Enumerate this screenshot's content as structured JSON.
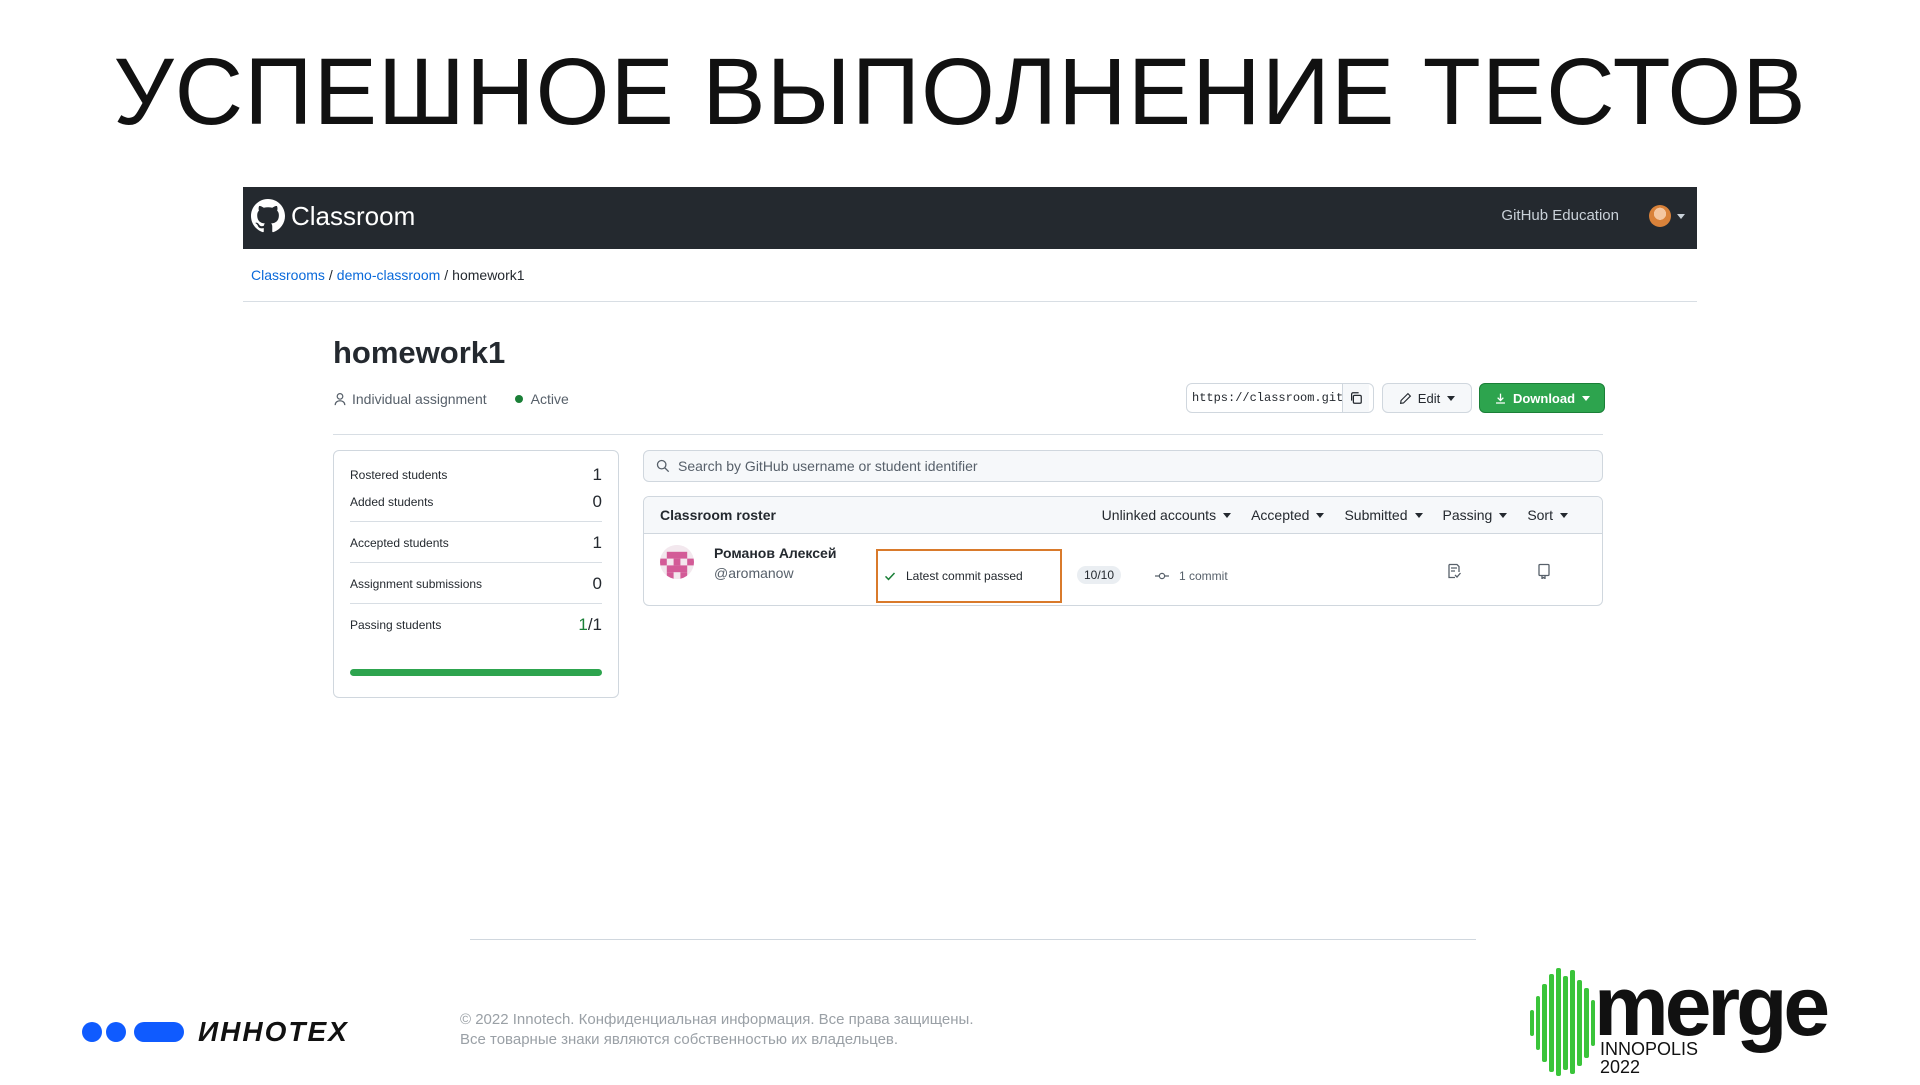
{
  "slide": {
    "title": "УСПЕШНОЕ ВЫПОЛНЕНИЕ ТЕСТОВ"
  },
  "topbar": {
    "app_name": "Classroom",
    "github_education": "GitHub Education",
    "logo_icon": "github-octocat-icon"
  },
  "breadcrumb": {
    "classrooms": "Classrooms",
    "classroom": "demo-classroom",
    "assignment": "homework1",
    "separator": "/"
  },
  "assignment": {
    "title": "homework1",
    "type": "Individual assignment",
    "status": "Active",
    "status_color": "#1a7f37",
    "url": "https://classroom.git",
    "edit_label": "Edit",
    "download_label": "Download",
    "download_color": "#2da44e"
  },
  "stats": {
    "rostered_label": "Rostered students",
    "rostered_value": "1",
    "added_label": "Added students",
    "added_value": "0",
    "accepted_label": "Accepted students",
    "accepted_value": "1",
    "submissions_label": "Assignment submissions",
    "submissions_value": "0",
    "passing_label": "Passing students",
    "passing_num": "1",
    "passing_den": "/1",
    "passing_fraction": 1.0
  },
  "search": {
    "placeholder": "Search by GitHub username or student identifier"
  },
  "roster": {
    "title": "Classroom roster",
    "filters": [
      "Unlinked accounts",
      "Accepted",
      "Submitted",
      "Passing",
      "Sort"
    ],
    "student": {
      "name": "Романов Алексей",
      "login": "@aromanow",
      "commit_status": "Latest commit passed",
      "score": "10/10",
      "commits": "1 commit"
    }
  },
  "footer": {
    "company": "ИННОТЕХ",
    "legal_line1": "© 2022 Innotech. Конфиденциальная информация. Все права защищены.",
    "legal_line2": "Все товарные знаки являются собственностью их владельцев.",
    "event_logo": "merge",
    "event_city": "INNOPOLIS",
    "event_year": "2022",
    "brand_blue": "#0f5bff",
    "merge_green": "#3ac43a"
  }
}
